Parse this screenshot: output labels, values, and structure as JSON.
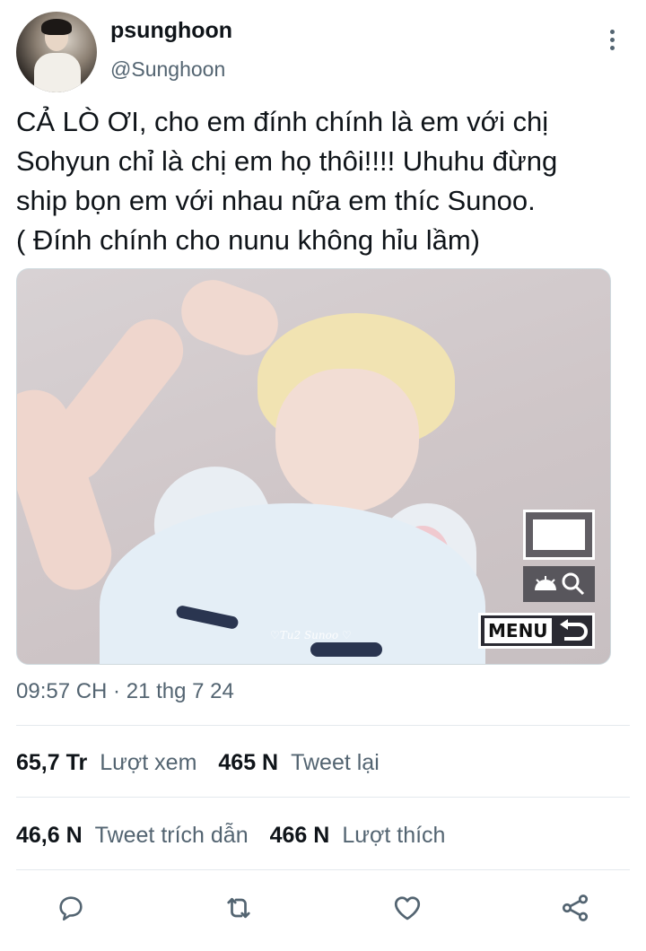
{
  "tweet": {
    "display_name": "psunghoon",
    "handle": "@Sunghoon",
    "text": "CẢ LÒ ƠI, cho em đính chính là em với chị\nSohyun chỉ là chị em họ thôi!!!! Uhuhu đừng\nship bọn em với nhau nữa em thíc Sunoo.\n( Đính chính cho nunu không hỉu lầm)",
    "timestamp": "09:57 CH · 21 thg 7 24"
  },
  "media": {
    "watermark": "♡Tu2 Sunoo ♡",
    "menu_label": "MENU"
  },
  "stats": {
    "views_count": "65,7 Tr",
    "views_label": "Lượt xem",
    "retweets_count": "465 N",
    "retweets_label": "Tweet lại",
    "quotes_count": "46,6 N",
    "quotes_label": "Tweet trích dẫn",
    "likes_count": "466 N",
    "likes_label": "Lượt thích"
  },
  "actions": {
    "icons": [
      "reply-icon",
      "retweet-icon",
      "like-icon",
      "share-icon"
    ]
  },
  "colors": {
    "text_primary": "#0f1419",
    "text_secondary": "#536471",
    "divider": "#e4e9ed"
  }
}
